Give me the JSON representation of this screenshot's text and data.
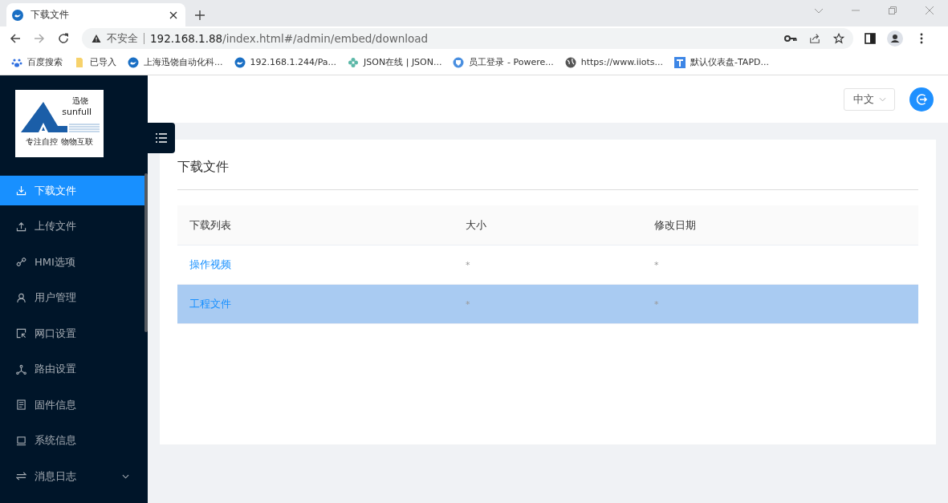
{
  "browser": {
    "tab": {
      "title": "下载文件"
    },
    "address": {
      "warning": "不安全",
      "host": "192.168.1.88",
      "path": "/index.html#/admin/embed/download"
    },
    "bookmarks": [
      {
        "kind": "paw",
        "label": "百度搜索"
      },
      {
        "kind": "folder",
        "label": "已导入"
      },
      {
        "kind": "logo",
        "label": "上海迅饶自动化科..."
      },
      {
        "kind": "logo",
        "label": "192.168.1.244/Pa..."
      },
      {
        "kind": "flower",
        "label": "JSON在线 | JSON..."
      },
      {
        "kind": "shield",
        "label": "员工登录 - Powere..."
      },
      {
        "kind": "globe",
        "label": "https://www.iiots..."
      },
      {
        "kind": "tapd",
        "label": "默认仪表盘-TAPD..."
      }
    ]
  },
  "sidebar": {
    "logo": {
      "name_cn": "迅饶",
      "name_en": "sunfull",
      "slogan": "专注自控 物物互联"
    },
    "items": [
      {
        "kind": "download",
        "label": "下载文件",
        "selected": true
      },
      {
        "kind": "upload",
        "label": "上传文件",
        "selected": false
      },
      {
        "kind": "link",
        "label": "HMI选项",
        "selected": false
      },
      {
        "kind": "user",
        "label": "用户管理",
        "selected": false
      },
      {
        "kind": "network",
        "label": "网口设置",
        "selected": false
      },
      {
        "kind": "route",
        "label": "路由设置",
        "selected": false
      },
      {
        "kind": "firmware",
        "label": "固件信息",
        "selected": false
      },
      {
        "kind": "system",
        "label": "系统信息",
        "selected": false
      },
      {
        "kind": "log",
        "label": "消息日志",
        "selected": false,
        "submenu": {
          "expanded": false
        }
      }
    ]
  },
  "header": {
    "language": "中文"
  },
  "card": {
    "title": "下载文件",
    "table": {
      "columns": [
        "下载列表",
        "大小",
        "修改日期"
      ],
      "rows": [
        {
          "name": "操作视频",
          "size": "*",
          "date": "*",
          "selected": false
        },
        {
          "name": "工程文件",
          "size": "*",
          "date": "*",
          "selected": true
        }
      ]
    }
  }
}
